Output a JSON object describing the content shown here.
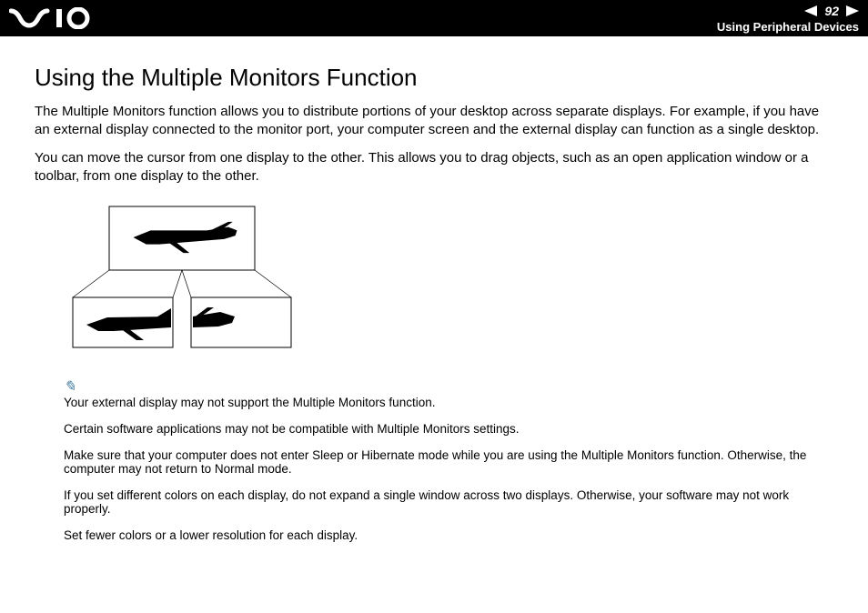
{
  "header": {
    "page_number": "92",
    "section": "Using Peripheral Devices"
  },
  "content": {
    "title": "Using the Multiple Monitors Function",
    "para1": "The Multiple Monitors function allows you to distribute portions of your desktop across separate displays. For example, if you have an external display connected to the monitor port, your computer screen and the external display can function as a single desktop.",
    "para2": "You can move the cursor from one display to the other. This allows you to drag objects, such as an open application window or a toolbar, from one display to the other."
  },
  "notes": {
    "n1": "Your external display may not support the Multiple Monitors function.",
    "n2": "Certain software applications may not be compatible with Multiple Monitors settings.",
    "n3": "Make sure that your computer does not enter Sleep or Hibernate mode while you are using the Multiple Monitors function. Otherwise, the computer may not return to Normal mode.",
    "n4": "If you set different colors on each display, do not expand a single window across two displays. Otherwise, your software may not work properly.",
    "n5": "Set fewer colors or a lower resolution for each display."
  }
}
